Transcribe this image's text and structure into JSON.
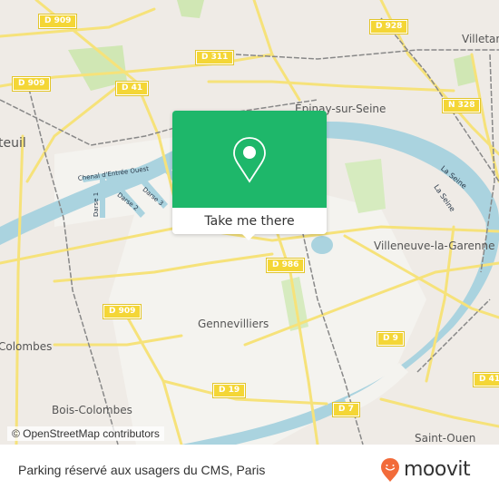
{
  "map": {
    "places": [
      {
        "id": "argenteuil",
        "label": "teuil"
      },
      {
        "id": "epinay",
        "label": "Épinay-sur-Seine"
      },
      {
        "id": "villetaneuse",
        "label": "Villetan"
      },
      {
        "id": "villeneuve",
        "label": "Villeneuve-la-Garenne"
      },
      {
        "id": "gennevilliers",
        "label": "Gennevilliers"
      },
      {
        "id": "colombes",
        "label": "Colombes"
      },
      {
        "id": "bois-colombes",
        "label": "Bois-Colombes"
      },
      {
        "id": "saint-ouen",
        "label": "Saint-Ouen"
      }
    ],
    "water_labels": [
      {
        "id": "chenal",
        "label": "Chenal d'Entrée Ouest"
      },
      {
        "id": "darse1",
        "label": "Darse 1"
      },
      {
        "id": "darse2",
        "label": "Darse 2"
      },
      {
        "id": "darse3",
        "label": "Darse 3"
      },
      {
        "id": "seine1",
        "label": "La Seine"
      },
      {
        "id": "seine2",
        "label": "La Seine"
      }
    ],
    "road_shields": [
      {
        "id": "d909-a",
        "label": "D 909"
      },
      {
        "id": "d909-b",
        "label": "D 909"
      },
      {
        "id": "d909-c",
        "label": "D 909"
      },
      {
        "id": "d41-a",
        "label": "D 41"
      },
      {
        "id": "d41-b",
        "label": "D 41"
      },
      {
        "id": "d311",
        "label": "D 311"
      },
      {
        "id": "d928",
        "label": "D 928"
      },
      {
        "id": "n328",
        "label": "N 328"
      },
      {
        "id": "d986",
        "label": "D 986"
      },
      {
        "id": "d9",
        "label": "D 9"
      },
      {
        "id": "d19",
        "label": "D 19"
      },
      {
        "id": "d7",
        "label": "D 7"
      }
    ],
    "attribution": "© OpenStreetMap contributors",
    "colors": {
      "land": "#f2efe9",
      "water": "#aad3df",
      "road": "#f6e27a",
      "park": "#c8e6a8"
    }
  },
  "popup": {
    "icon": "map-pin-icon",
    "button_label": "Take me there",
    "accent_color": "#1eb76a"
  },
  "footer": {
    "title": "Parking réservé aux usagers du CMS, Paris",
    "brand": "moovit",
    "brand_icon": "moovit-logo-icon",
    "brand_color": "#f26b3a"
  }
}
